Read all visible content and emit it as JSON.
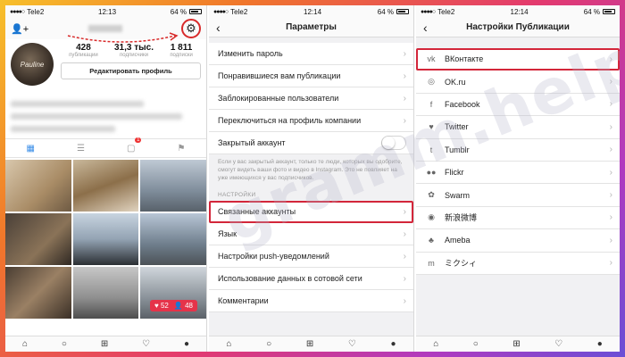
{
  "watermark": "gramm.help",
  "panels": [
    {
      "status": {
        "carrier": "Tele2",
        "time": "12:13",
        "battery": "64 %"
      },
      "profile": {
        "avatar_text": "Pauline",
        "stats": [
          {
            "num": "428",
            "label": "публикации"
          },
          {
            "num": "31,3 тыс.",
            "label": "подписчики"
          },
          {
            "num": "1 811",
            "label": "подписки"
          }
        ],
        "edit_button": "Редактировать профиль",
        "activity_badge": "1",
        "likes": "52",
        "followers": "48"
      }
    },
    {
      "status": {
        "carrier": "Tele2",
        "time": "12:14",
        "battery": "64 %"
      },
      "title": "Параметры",
      "items_top": [
        "Изменить пароль",
        "Понравившиеся вам публикации",
        "Заблокированные пользователи",
        "Переключиться на профиль компании"
      ],
      "private_label": "Закрытый аккаунт",
      "private_note": "Если у вас закрытый аккаунт, только те люди, которых вы одобрите, смогут видеть ваши фото и видео в Instagram. Это не повлияет на уже имеющихся у вас подписчиков.",
      "section": "НАСТРОЙКИ",
      "items_bottom": [
        "Связанные аккаунты",
        "Язык",
        "Настройки push-уведомлений",
        "Использование данных в сотовой сети",
        "Комментарии"
      ]
    },
    {
      "status": {
        "carrier": "Tele2",
        "time": "12:14",
        "battery": "64 %"
      },
      "title": "Настройки Публикации",
      "services": [
        {
          "label": "ВКонтакте",
          "icon": "vk-icon",
          "glyph": "vk"
        },
        {
          "label": "OK.ru",
          "icon": "ok-icon",
          "glyph": "◎"
        },
        {
          "label": "Facebook",
          "icon": "facebook-icon",
          "glyph": "f"
        },
        {
          "label": "Twitter",
          "icon": "twitter-icon",
          "glyph": "♥"
        },
        {
          "label": "Tumblr",
          "icon": "tumblr-icon",
          "glyph": "t"
        },
        {
          "label": "Flickr",
          "icon": "flickr-icon",
          "glyph": "●●"
        },
        {
          "label": "Swarm",
          "icon": "swarm-icon",
          "glyph": "✿"
        },
        {
          "label": "新浪微博",
          "icon": "weibo-icon",
          "glyph": "◉"
        },
        {
          "label": "Ameba",
          "icon": "ameba-icon",
          "glyph": "♣"
        },
        {
          "label": "ミクシィ",
          "icon": "mixi-icon",
          "glyph": "m"
        }
      ]
    }
  ]
}
